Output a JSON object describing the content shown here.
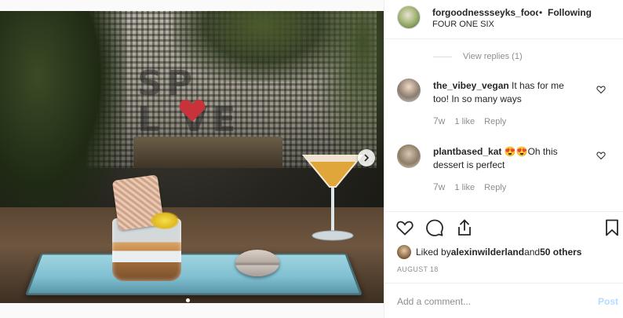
{
  "header": {
    "username": "forgoodnessseyks_food",
    "separator": "•",
    "follow_label": "Following",
    "location": "FOUR ONE SIX"
  },
  "photo": {
    "wall_text_line1": "SP",
    "wall_text_line2": "L  VE",
    "carousel_next_icon": "chevron-right-icon"
  },
  "view_replies_label": "View replies (1)",
  "comments": [
    {
      "user": "the_vibey_vegan",
      "text": " It has for me too! In so many ways",
      "time": "7w",
      "likes": "1 like",
      "reply": "Reply"
    },
    {
      "user": "plantbased_kat",
      "text": " 😍😍Oh this dessert is perfect",
      "time": "7w",
      "likes": "1 like",
      "reply": "Reply"
    }
  ],
  "actions": {
    "like_icon": "heart-icon",
    "comment_icon": "comment-icon",
    "share_icon": "share-icon",
    "save_icon": "bookmark-icon"
  },
  "likes": {
    "prefix": "Liked by ",
    "user": "alexinwilderland",
    "middle": " and ",
    "others": "50 others"
  },
  "post_date": "AUGUST 18",
  "comment_box": {
    "placeholder": "Add a comment...",
    "post_label": "Post"
  },
  "colors": {
    "accent_link": "#262626",
    "post_button_disabled": "#b3dbff",
    "meta_gray": "#8e8e8e"
  }
}
